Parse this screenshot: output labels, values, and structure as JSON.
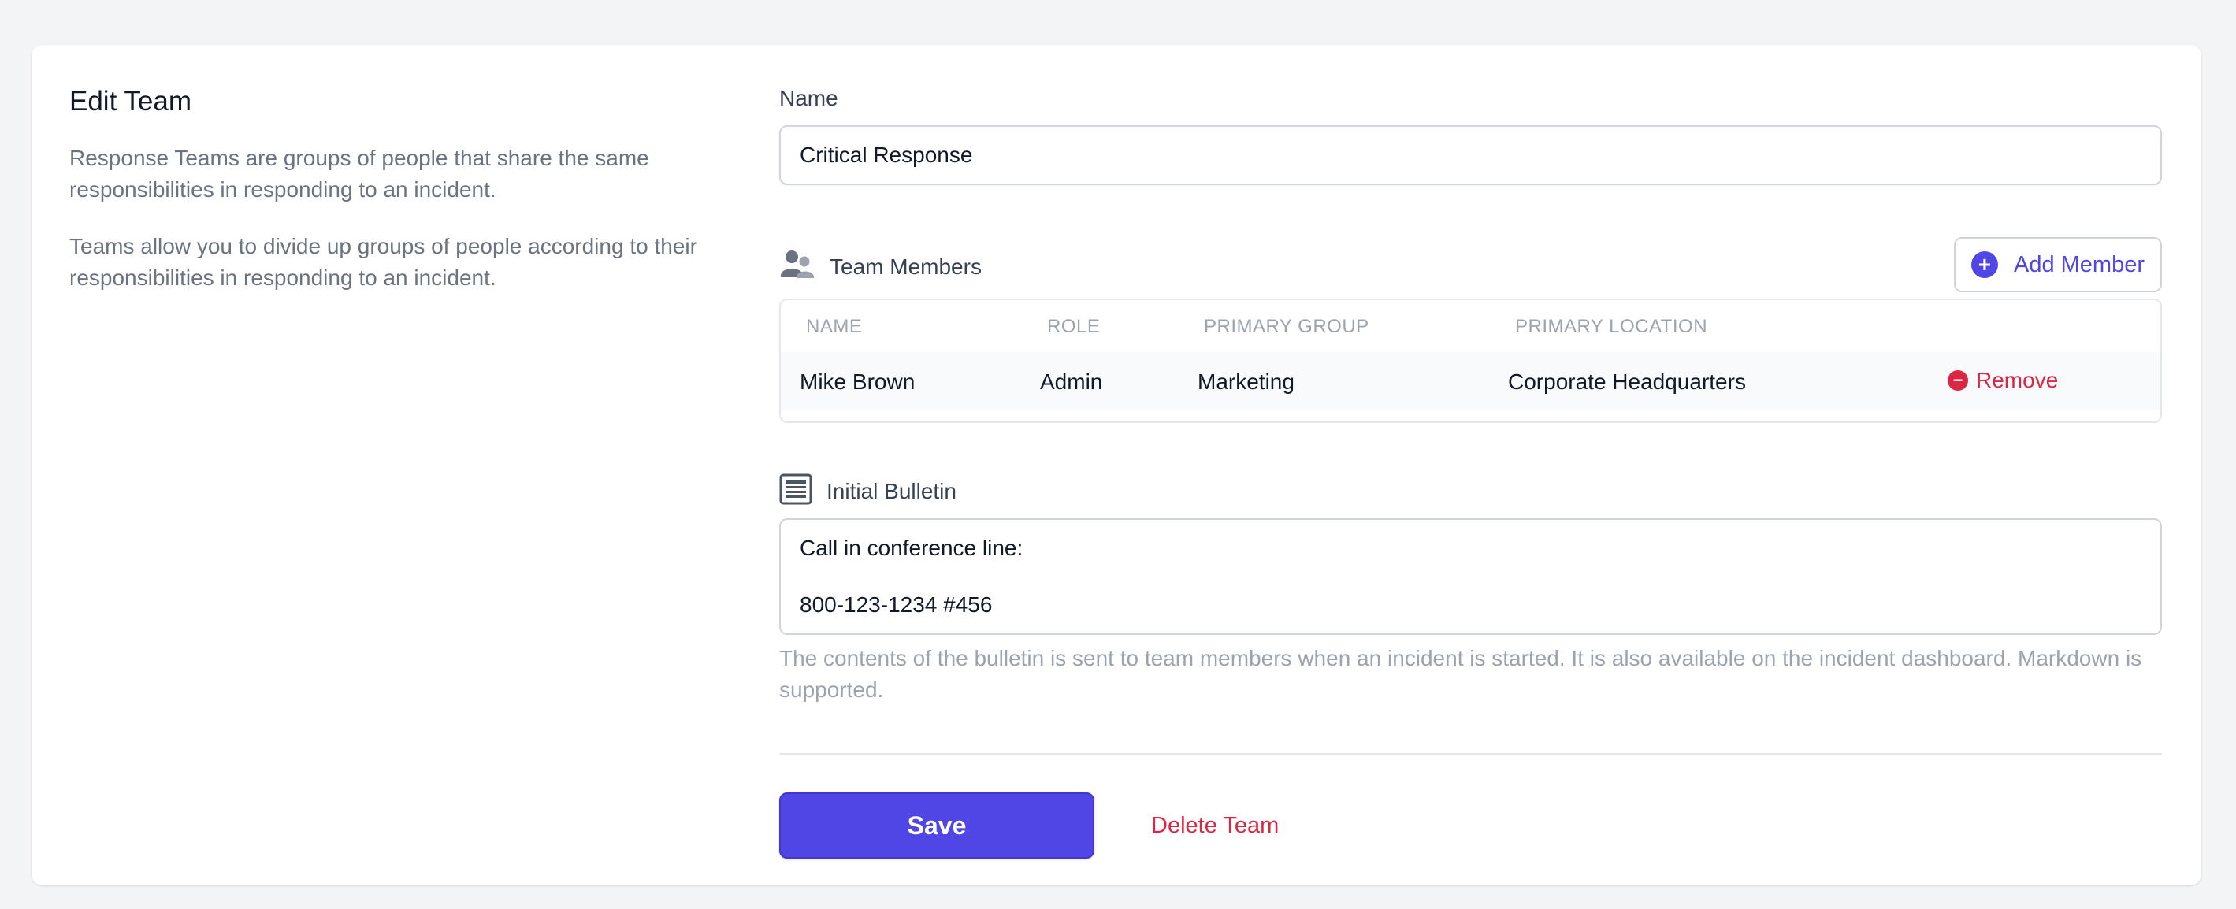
{
  "sidebar": {
    "title": "Edit Team",
    "paragraphs": [
      "Response Teams are groups of people that share the same responsibilities in responding to an incident.",
      "Teams allow you to divide up groups of people according to their responsibilities in responding to an incident."
    ]
  },
  "form": {
    "name_label": "Name",
    "name_value": "Critical Response",
    "members": {
      "title": "Team Members",
      "icon": "users-icon",
      "add_label": "Add Member",
      "columns": [
        "NAME",
        "ROLE",
        "PRIMARY GROUP",
        "PRIMARY LOCATION"
      ],
      "rows": [
        {
          "name": "Mike Brown",
          "role": "Admin",
          "group": "Marketing",
          "location": "Corporate Headquarters",
          "action": "Remove"
        }
      ]
    },
    "bulletin": {
      "title": "Initial Bulletin",
      "icon": "newspaper-icon",
      "lines": [
        "Call in conference line:",
        "",
        "800-123-1234 #456"
      ],
      "help": "The contents of the bulletin is sent to team members when an incident is started. It is also available on the incident dashboard. Markdown is supported."
    },
    "save_label": "Save",
    "delete_label": "Delete Team"
  },
  "colors": {
    "accent": "#4f46e5",
    "danger": "#dc2643",
    "muted": "#9ca3af"
  }
}
